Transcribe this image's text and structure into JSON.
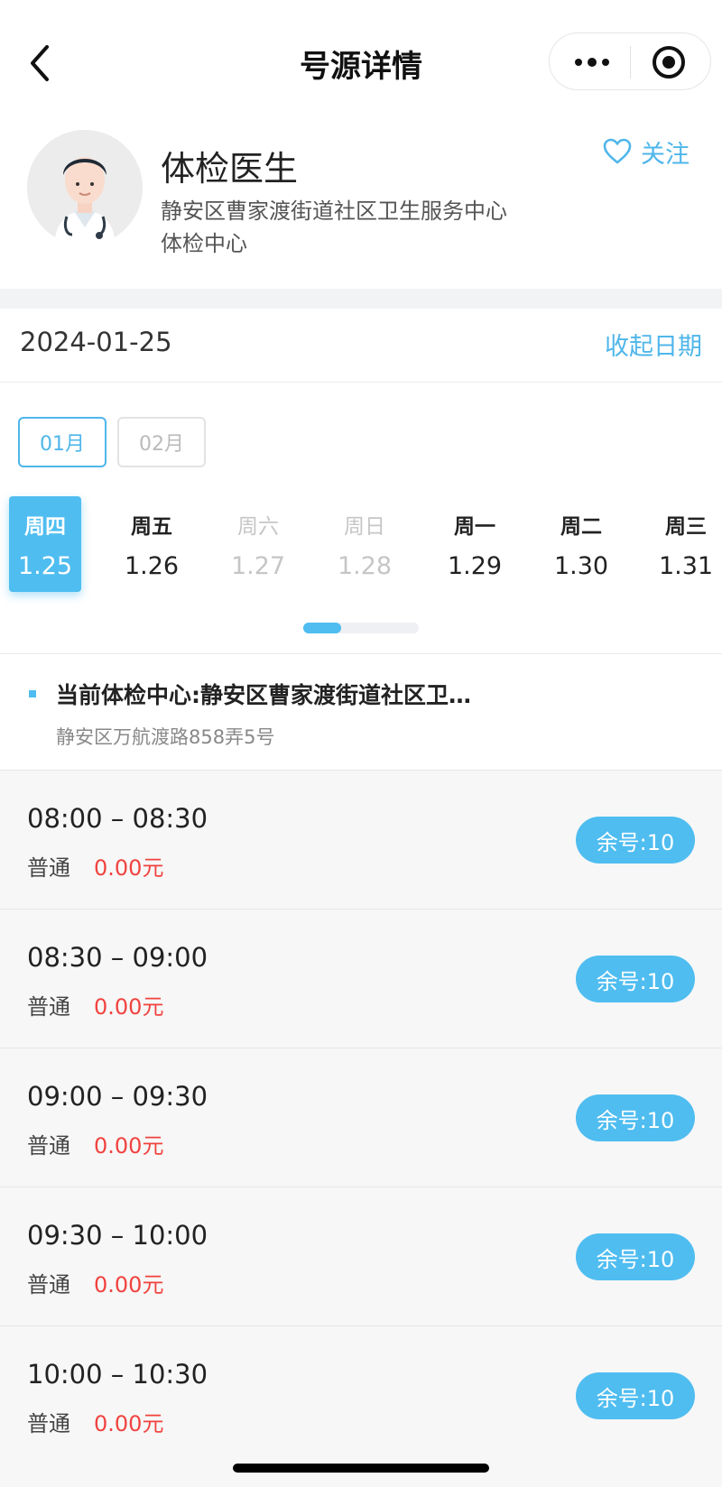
{
  "nav": {
    "title": "号源详情"
  },
  "doctor": {
    "name": "体检医生",
    "hospital_line1": "静安区曹家渡街道社区卫生服务中心",
    "hospital_line2": "体检中心",
    "follow_label": "关注"
  },
  "date_header": {
    "current_date": "2024-01-25",
    "collapse_label": "收起日期"
  },
  "months": [
    {
      "label": "01月",
      "active": true
    },
    {
      "label": "02月",
      "active": false
    }
  ],
  "days": [
    {
      "weekday": "周四",
      "date": "1.25",
      "state": "selected"
    },
    {
      "weekday": "周五",
      "date": "1.26",
      "state": "available"
    },
    {
      "weekday": "周六",
      "date": "1.27",
      "state": "disabled"
    },
    {
      "weekday": "周日",
      "date": "1.28",
      "state": "disabled"
    },
    {
      "weekday": "周一",
      "date": "1.29",
      "state": "available"
    },
    {
      "weekday": "周二",
      "date": "1.30",
      "state": "available"
    },
    {
      "weekday": "周三",
      "date": "1.31",
      "state": "available"
    }
  ],
  "center": {
    "name": "当前体检中心:静安区曹家渡街道社区卫…",
    "address": "静安区万航渡路858弄5号"
  },
  "slots": [
    {
      "time": "08:00 – 08:30",
      "type": "普通",
      "price": "0.00元",
      "remaining": "余号:10"
    },
    {
      "time": "08:30 – 09:00",
      "type": "普通",
      "price": "0.00元",
      "remaining": "余号:10"
    },
    {
      "time": "09:00 – 09:30",
      "type": "普通",
      "price": "0.00元",
      "remaining": "余号:10"
    },
    {
      "time": "09:30 – 10:00",
      "type": "普通",
      "price": "0.00元",
      "remaining": "余号:10"
    },
    {
      "time": "10:00 – 10:30",
      "type": "普通",
      "price": "0.00元",
      "remaining": "余号:10"
    }
  ],
  "colors": {
    "accent": "#4fbdf0",
    "price": "#f0433f"
  },
  "icons": {
    "back": "chevron-left-icon",
    "more": "more-dots-icon",
    "close": "mini-program-close-icon",
    "follow": "heart-outline-icon"
  }
}
